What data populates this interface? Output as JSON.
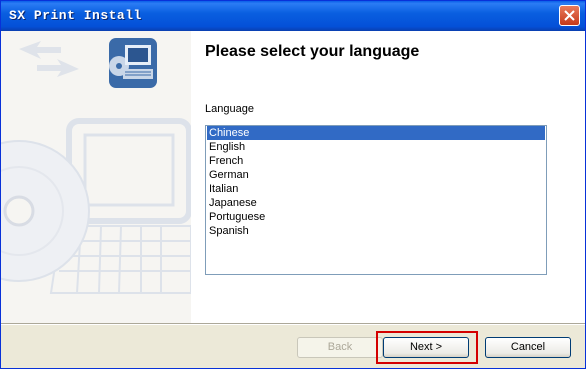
{
  "window": {
    "title": "SX Print Install"
  },
  "main": {
    "heading": "Please select your language",
    "language_label": "Language",
    "languages": [
      "Chinese",
      "English",
      "French",
      "German",
      "Italian",
      "Japanese",
      "Portuguese",
      "Spanish"
    ],
    "selected_index": 0
  },
  "buttons": {
    "back": "Back",
    "next": "Next >",
    "cancel": "Cancel"
  },
  "colors": {
    "selection": "#316ac5",
    "title_bar": "#0a5fe0",
    "highlight_box": "#d40000"
  }
}
